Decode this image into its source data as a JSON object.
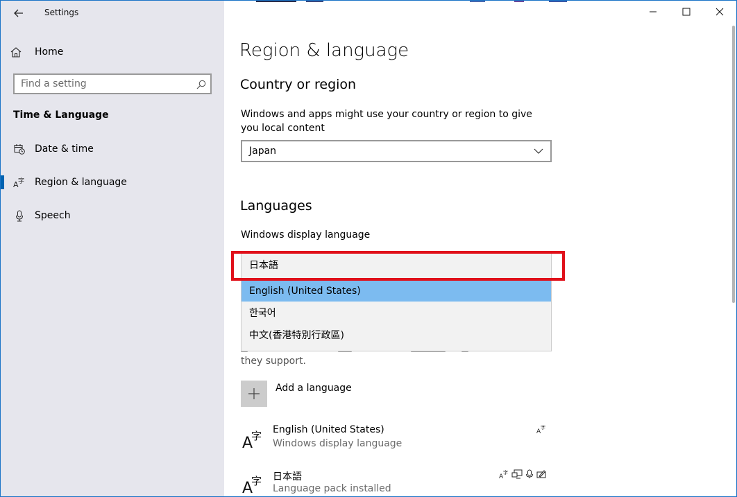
{
  "window": {
    "title": "Settings"
  },
  "sidebar": {
    "home_label": "Home",
    "search_placeholder": "Find a setting",
    "section_label": "Time & Language",
    "items": [
      {
        "label": "Date & time",
        "icon": "calendar-clock-icon"
      },
      {
        "label": "Region & language",
        "icon": "language-icon",
        "active": true
      },
      {
        "label": "Speech",
        "icon": "microphone-icon"
      }
    ]
  },
  "main": {
    "page_title": "Region & language",
    "country": {
      "heading": "Country or region",
      "description": "Windows and apps might use your country or region to give you local content",
      "selected": "Japan"
    },
    "languages": {
      "heading": "Languages",
      "display_language_label": "Windows display language",
      "options": [
        "日本語",
        "English (United States)",
        "한국어",
        "中文(香港特別行政區)"
      ],
      "selected_option": "English (United States)",
      "tail_text": "they support.",
      "add_label": "Add a language",
      "installed": [
        {
          "name": "English (United States)",
          "desc": "Windows display language"
        },
        {
          "name": "日本語",
          "desc": "Language pack installed"
        }
      ]
    }
  },
  "colors": {
    "accent": "#0063b1",
    "selection": "#7cbbf0",
    "highlight": "#e0101a",
    "sidebar_bg": "#e6e6ed"
  }
}
